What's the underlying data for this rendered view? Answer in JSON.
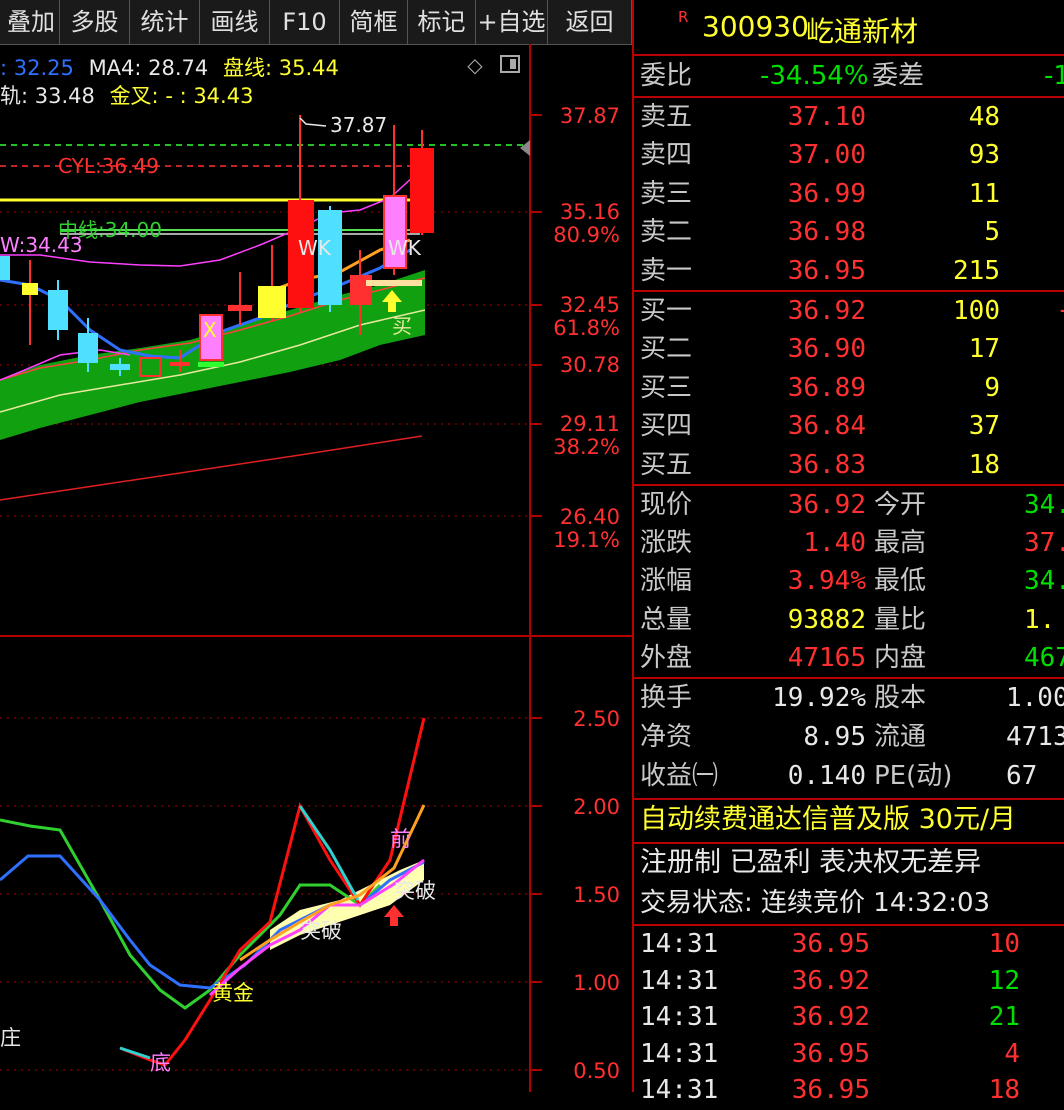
{
  "toolbar": {
    "items": [
      "叠加",
      "多股",
      "统计",
      "画线",
      "F10",
      "简框",
      "标记",
      "+自选",
      "返回"
    ]
  },
  "legend": {
    "line1": [
      {
        "text": ": 32.25",
        "color": "#3070ff"
      },
      {
        "text": "MA4: 28.74",
        "color": "#e8e8e8"
      },
      {
        "text": "盘线: 35.44",
        "color": "#ffff30"
      }
    ],
    "line2": [
      {
        "text": "轨: 33.48",
        "color": "#e8e8e8"
      },
      {
        "text": "金叉: - : 34.43",
        "color": "#ffff30"
      }
    ]
  },
  "price_axis": {
    "labels": [
      "37.87",
      "35.16",
      "80.9%",
      "32.45",
      "61.8%",
      "30.78",
      "29.11",
      "38.2%",
      "26.40",
      "19.1%"
    ]
  },
  "chart_annotations": {
    "high_label": "37.87",
    "cyl_label": "CYL:36.49",
    "support_label": "中线:34.00",
    "w_label": "W:34.43",
    "wk1": "WK",
    "wk2": "WK",
    "buy_label": "买",
    "x_mark": "X"
  },
  "indicator_axis": {
    "labels": [
      "2.50",
      "2.00",
      "1.50",
      "1.00",
      "0.50"
    ]
  },
  "indicator_annotations": {
    "huangjin": "黄金",
    "tupo1": "突破",
    "tupo2": "突破",
    "qian": "前",
    "di": "底",
    "zhu": "庄"
  },
  "colors": {
    "up": "#ff3030",
    "down": "#00e000",
    "cyan": "#50e0ff",
    "yellow": "#ffff30",
    "magenta": "#ff40ff",
    "blue": "#3070ff",
    "orange": "#ffa020",
    "grid_red": "#b00000"
  },
  "stock": {
    "badge": "R",
    "code": "300930",
    "name": "屹通新材"
  },
  "weibi": {
    "label": "委比",
    "value": "-34.54%",
    "label2": "委差",
    "value2": "-1"
  },
  "asks": [
    {
      "label": "卖五",
      "price": "37.10",
      "vol": "48"
    },
    {
      "label": "卖四",
      "price": "37.00",
      "vol": "93"
    },
    {
      "label": "卖三",
      "price": "36.99",
      "vol": "11"
    },
    {
      "label": "卖二",
      "price": "36.98",
      "vol": "5"
    },
    {
      "label": "卖一",
      "price": "36.95",
      "vol": "215"
    }
  ],
  "bids": [
    {
      "label": "买一",
      "price": "36.92",
      "vol": "100",
      "tail": "+"
    },
    {
      "label": "买二",
      "price": "36.90",
      "vol": "17"
    },
    {
      "label": "买三",
      "price": "36.89",
      "vol": "9"
    },
    {
      "label": "买四",
      "price": "36.84",
      "vol": "37"
    },
    {
      "label": "买五",
      "price": "36.83",
      "vol": "18"
    }
  ],
  "quote": [
    {
      "l1": "现价",
      "v1": "36.92",
      "c1": "#ff3030",
      "l2": "今开",
      "v2": "34.",
      "c2": "#00e000"
    },
    {
      "l1": "涨跌",
      "v1": "1.40",
      "c1": "#ff3030",
      "l2": "最高",
      "v2": "37.",
      "c2": "#ff3030"
    },
    {
      "l1": "涨幅",
      "v1": "3.94%",
      "c1": "#ff3030",
      "l2": "最低",
      "v2": "34.",
      "c2": "#00e000"
    },
    {
      "l1": "总量",
      "v1": "93882",
      "c1": "#ffff30",
      "l2": "量比",
      "v2": "1.",
      "c2": "#ffff30"
    },
    {
      "l1": "外盘",
      "v1": "47165",
      "c1": "#ff3030",
      "l2": "内盘",
      "v2": "467",
      "c2": "#00e000"
    }
  ],
  "finance": [
    {
      "l1": "换手",
      "v1": "19.92%",
      "l2": "股本",
      "v2": "1.00"
    },
    {
      "l1": "净资",
      "v1": "8.95",
      "l2": "流通",
      "v2": "4713"
    },
    {
      "l1": "收益㈠",
      "v1": "0.140",
      "l2": "PE(动)",
      "v2": "67"
    }
  ],
  "promo": "自动续费通达信普及版 30元/月",
  "tags": "注册制 已盈利 表决权无差异",
  "trade_status": "交易状态: 连续竞价 14:32:03",
  "ticks": [
    {
      "time": "14:31",
      "price": "36.95",
      "vol": "10",
      "vc": "#ff3030"
    },
    {
      "time": "14:31",
      "price": "36.92",
      "vol": "12",
      "vc": "#00e000"
    },
    {
      "time": "14:31",
      "price": "36.92",
      "vol": "21",
      "vc": "#00e000"
    },
    {
      "time": "14:31",
      "price": "36.95",
      "vol": "4",
      "vc": "#ff3030"
    },
    {
      "time": "14:31",
      "price": "36.95",
      "vol": "18",
      "vc": "#ff3030"
    }
  ]
}
